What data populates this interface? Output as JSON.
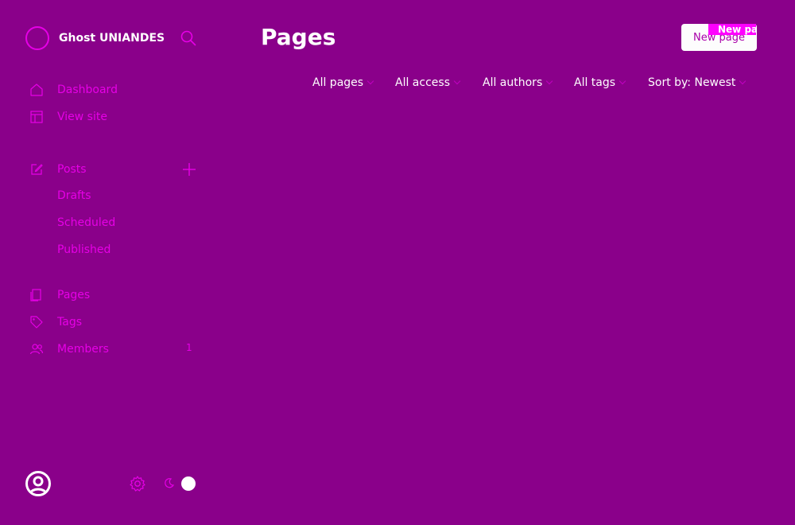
{
  "brand": {
    "name": "Ghost UNIANDES",
    "logo_icon": "ghost-logo-icon"
  },
  "sidebar": {
    "search_icon": "search-icon",
    "items": [
      {
        "label": "Dashboard",
        "icon": "home-icon"
      },
      {
        "label": "View site",
        "icon": "window-icon"
      },
      {
        "label": "Posts",
        "icon": "edit-icon"
      },
      {
        "label": "Pages",
        "icon": "pages-icon"
      },
      {
        "label": "Tags",
        "icon": "tag-icon"
      },
      {
        "label": "Members",
        "icon": "members-icon",
        "count": "1"
      }
    ],
    "post_subitems": [
      {
        "label": "Drafts"
      },
      {
        "label": "Scheduled"
      },
      {
        "label": "Published"
      }
    ],
    "footer": {
      "settings_icon": "gear-icon",
      "theme_icon": "moon-icon"
    }
  },
  "main": {
    "title": "Pages",
    "new_button": "New page",
    "new_badge": "New pag",
    "filters": [
      {
        "label": "All pages"
      },
      {
        "label": "All access"
      },
      {
        "label": "All authors"
      },
      {
        "label": "All tags"
      },
      {
        "label": "Sort by: Newest"
      }
    ]
  },
  "colors": {
    "background": "#8a008a",
    "accent": "#e600e6",
    "text": "#ffffff",
    "badge": "#ff00ff"
  }
}
